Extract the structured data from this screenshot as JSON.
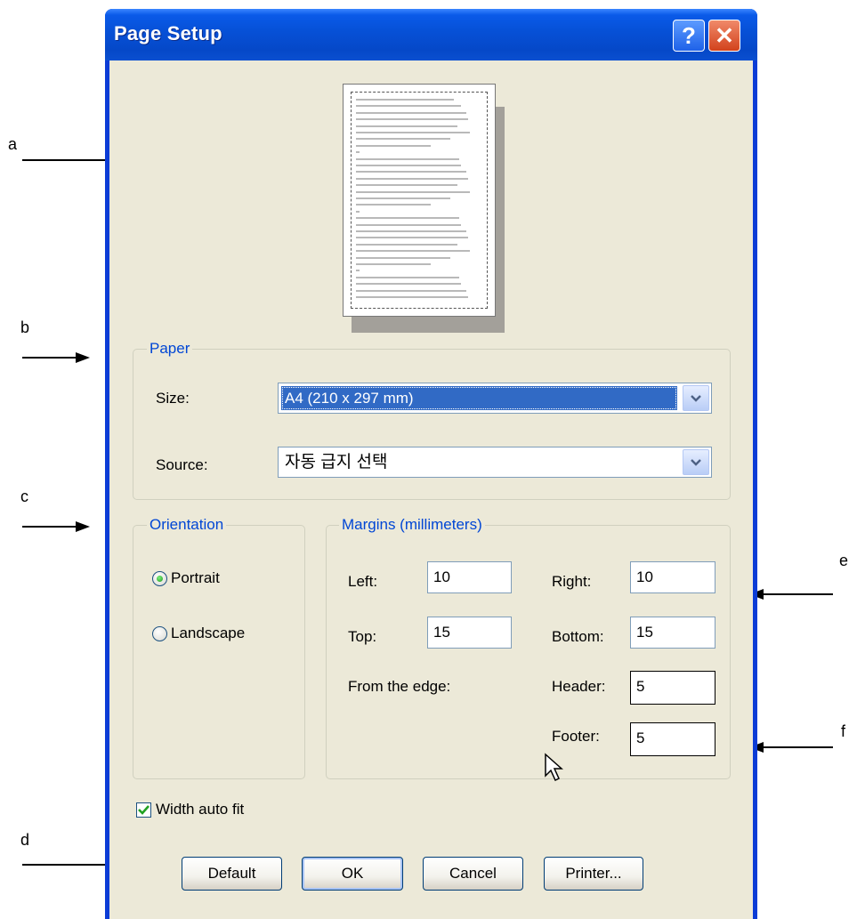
{
  "dialog": {
    "title": "Page Setup"
  },
  "titlebar_buttons": {
    "help": "?",
    "close": "✕"
  },
  "annotations": [
    "a",
    "b",
    "c",
    "d",
    "e",
    "f"
  ],
  "paper": {
    "group_label": "Paper",
    "size_label": "Size:",
    "size_value": "A4 (210 x 297 mm)",
    "source_label": "Source:",
    "source_value": "자동 급지 선택"
  },
  "orientation": {
    "group_label": "Orientation",
    "portrait": "Portrait",
    "landscape": "Landscape",
    "selected": "Portrait"
  },
  "margins": {
    "group_label": "Margins (millimeters)",
    "left_label": "Left:",
    "left_value": "10",
    "right_label": "Right:",
    "right_value": "10",
    "top_label": "Top:",
    "top_value": "15",
    "bottom_label": "Bottom:",
    "bottom_value": "15",
    "from_edge_label": "From the edge:",
    "header_label": "Header:",
    "header_value": "5",
    "footer_label": "Footer:",
    "footer_value": "5"
  },
  "width_auto_fit": {
    "label": "Width auto fit",
    "checked": true
  },
  "buttons": {
    "default": "Default",
    "ok": "OK",
    "cancel": "Cancel",
    "printer": "Printer..."
  },
  "colors": {
    "title_bar": "#0548c8",
    "dialog_bg": "#ece9d8",
    "group_title": "#0046d5",
    "selection": "#316ac5",
    "close_button": "#d2421c"
  }
}
